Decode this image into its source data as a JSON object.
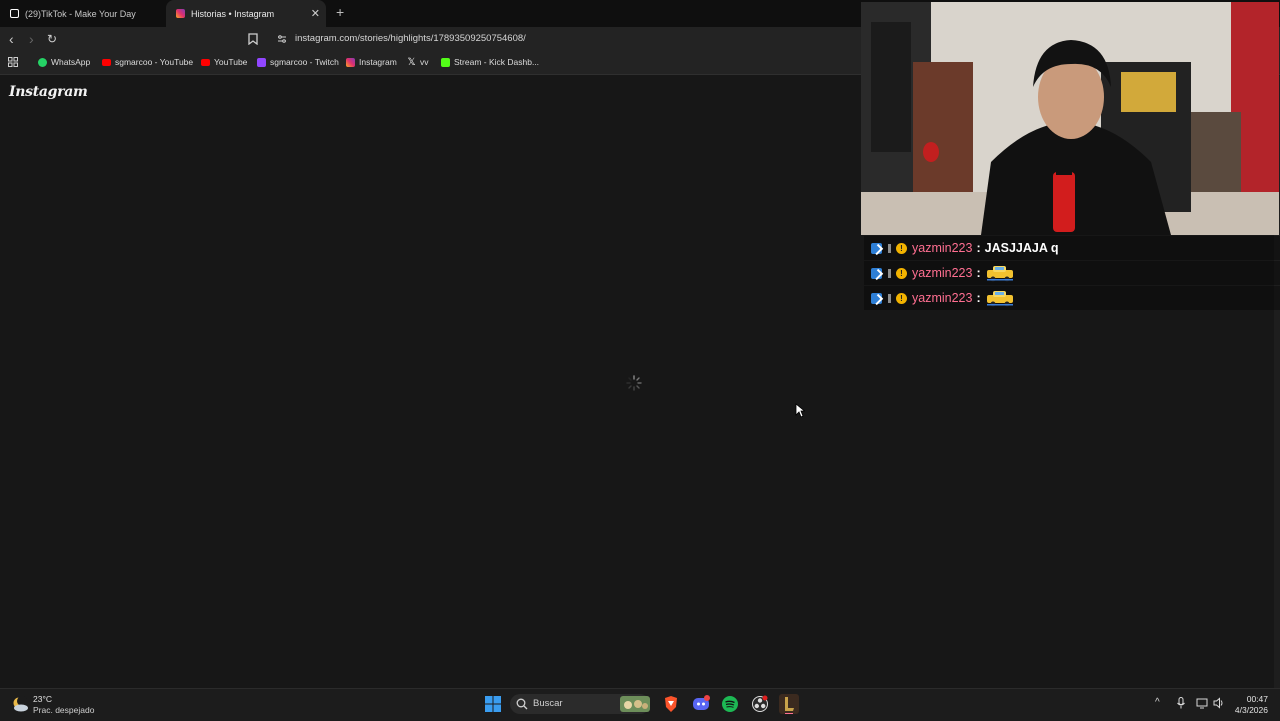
{
  "browser": {
    "tabs": [
      {
        "title": "(29)TikTok - Make Your Day",
        "active": false,
        "icon": "tiktok-icon"
      },
      {
        "title": "Historias • Instagram",
        "active": true,
        "icon": "instagram-icon"
      }
    ],
    "url": "instagram.com/stories/highlights/17893509250754608/",
    "bookmarks": [
      {
        "label": "WhatsApp",
        "icon": "whatsapp-icon",
        "color": "#25d366"
      },
      {
        "label": "sgmarcoo - YouTube",
        "icon": "youtube-icon",
        "color": "#ff0000"
      },
      {
        "label": "YouTube",
        "icon": "youtube-icon",
        "color": "#ff0000"
      },
      {
        "label": "sgmarcoo - Twitch",
        "icon": "twitch-icon",
        "color": "#9146ff"
      },
      {
        "label": "Instagram",
        "icon": "instagram-icon",
        "color": "#e1306c"
      },
      {
        "label": "vv",
        "icon": "x-icon",
        "color": "#ffffff"
      },
      {
        "label": "Stream - Kick Dashb...",
        "icon": "kick-icon",
        "color": "#53fc18"
      }
    ]
  },
  "page": {
    "logo": "Instagram"
  },
  "chat": [
    {
      "user": "yazmin223",
      "separator": ":",
      "message": "JASJJAJA q"
    },
    {
      "user": "yazmin223",
      "separator": ":",
      "message": "",
      "emote": "car-emote"
    },
    {
      "user": "yazmin223",
      "separator": ":",
      "message": "",
      "emote": "car-emote"
    }
  ],
  "taskbar": {
    "weather_temp": "23°C",
    "weather_desc": "Prac. despejado",
    "search_label": "Buscar",
    "time": "00:47",
    "date": "4/3/2026"
  },
  "colors": {
    "page_bg": "#171717",
    "chrome_bg": "#232323",
    "chat_username": "#ff6f91"
  }
}
